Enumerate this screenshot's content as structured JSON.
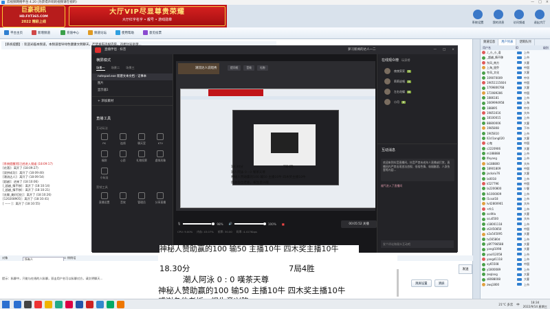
{
  "window": {
    "title": "云视频网络平台 4.20 (为获得声响的视频请在视听)",
    "controls": [
      "—",
      "□",
      "×"
    ]
  },
  "banner": {
    "logo_line1": "巨豪視訊",
    "logo_line2": "HD.FXT365.COM",
    "logo_line3": "2022 精彩上线",
    "vip_line1": "大厅VIP尽显尊贵荣耀",
    "vip_line2": "大厅红字名字 • 靓号 • 游戏勋章"
  },
  "toolbar": {
    "items": [
      {
        "label": "平台主页",
        "color": "#2f7fd0"
      },
      {
        "label": "新增频道",
        "color": "#d04848"
      },
      {
        "label": "充值中心",
        "color": "#3aa04a"
      },
      {
        "label": "频道论坛",
        "color": "#e09a22"
      },
      {
        "label": "使用帮助",
        "color": "#2f9fe0"
      },
      {
        "label": "意见投票",
        "color": "#8a4ad0"
      }
    ],
    "right": [
      {
        "label": "系统设置",
        "color": "#3a78c8"
      },
      {
        "label": "我的消息",
        "color": "#3a78c8"
      },
      {
        "label": "访问频道",
        "color": "#3a78c8"
      },
      {
        "label": "退出大厅",
        "color": "#3a78c8"
      }
    ]
  },
  "notice": "【系统提醒】: 欢迎光临本频道，本频道倡导绿色健康文明聊天，严禁发布违规内容，违者封号处理...",
  "chat": {
    "lines": [
      "[系统提醒]您已经进入频道 (18:09:17)",
      "[花落]：离开了 (18:09:27)",
      "[双拼成功]：离开了 (18:09:40)",
      "[潮流达人]：离开了 (18:09:54)",
      "[超越]：进来了 (18:10:06)",
      "[_超越_情不移]：离开了 (18:10:14)",
      "[_超越_情不移]：离开了 (18:10:21)",
      "[无聊_美好回忆]：离开了 (18:10:26)",
      "[120208905]：离开了 (18:10:41)",
      "[ —— ]：离开了 (18:10:55)"
    ]
  },
  "input": {
    "target_label": "对象",
    "target_value": "所有人",
    "private_label": "悄悄话",
    "send": "发送"
  },
  "broadcast": "提示：私聊中，只能与在线的人私聊，双击用户名可以私聊对方，请文明聊天...",
  "bottom_buttons": [
    "清屏设置",
    "清屏"
  ],
  "right_panel": {
    "tabs": [
      "频道信息",
      "用户列表",
      "话筒队列"
    ],
    "head": [
      "用户名",
      "ID",
      "级别"
    ],
    "users": [
      {
        "name": "♪_小_小_语",
        "id": "上市",
        "c": "#e05a5a"
      },
      {
        "name": "_超越_情不移",
        "id": "上市",
        "c": "#4aa04a"
      },
      {
        "name": "东风_南方",
        "id": "大客",
        "c": "#e05a5a"
      },
      {
        "name": "上海_银乔",
        "id": "中国",
        "c": "#e0a040"
      },
      {
        "name": "冬凤_文化",
        "id": "大客",
        "c": "#4aa04a"
      },
      {
        "name": "109070009",
        "id": "中华",
        "c": "#4aa04a"
      },
      {
        "name": "19051115604",
        "id": "中国",
        "c": "#e05a5a"
      },
      {
        "name": "1769806768",
        "id": "大客",
        "c": "#4aa04a"
      },
      {
        "name": "172089286",
        "id": "中国",
        "c": "#e0a040"
      },
      {
        "name": "1886181",
        "id": "上市",
        "c": "#4aa04a"
      },
      {
        "name": "1669994958",
        "id": "上海",
        "c": "#4aa04a"
      },
      {
        "name": "188895",
        "id": "中华",
        "c": "#4aa04a"
      },
      {
        "name": "19851616",
        "id": "大市",
        "c": "#e05a5a"
      },
      {
        "name": "18100015",
        "id": "上市",
        "c": "#4aa04a"
      },
      {
        "name": "88800006",
        "id": "大客",
        "c": "#4aa04a"
      },
      {
        "name": "1985808",
        "id": "下市",
        "c": "#e0a040"
      },
      {
        "name": "1905810",
        "id": "上市",
        "c": "#4aa04a"
      },
      {
        "name": "ll2cl1ang020",
        "id": "大客",
        "c": "#4aa04a"
      },
      {
        "name": "心鬼",
        "id": "中国",
        "c": "#e05a5a"
      },
      {
        "name": "c2220906",
        "id": "大客",
        "c": "#4aa04a"
      },
      {
        "name": "m188888",
        "id": "上市",
        "c": "#4aa04a"
      },
      {
        "name": "lfeyang",
        "id": "上市",
        "c": "#4aa04a"
      },
      {
        "name": "la188800",
        "id": "大市",
        "c": "#e0a040"
      },
      {
        "name": "18901809",
        "id": "中国",
        "c": "#4aa04a"
      },
      {
        "name": "jackalu76",
        "id": "大客",
        "c": "#4aa04a"
      },
      {
        "name": "la0018",
        "id": "上市",
        "c": "#4aa04a"
      },
      {
        "name": "k527796",
        "id": "中国",
        "c": "#e05a5a"
      },
      {
        "name": "la2200800",
        "id": "少客",
        "c": "#4aa04a"
      },
      {
        "name": "lk1000009",
        "id": "上市",
        "c": "#4aa04a"
      },
      {
        "name": "l1csal18",
        "id": "上市",
        "c": "#4aa04a"
      },
      {
        "name": "lv42800901",
        "id": "大市",
        "c": "#e0a040"
      },
      {
        "name": "•rfc1",
        "id": "上市",
        "c": "#e05a5a"
      },
      {
        "name": "scdltla",
        "id": "大客",
        "c": "#4aa04a"
      },
      {
        "name": "scu0500",
        "id": "大市",
        "c": "#4aa04a"
      },
      {
        "name": "s18001118",
        "id": "上市",
        "c": "#4aa04a"
      },
      {
        "name": "st2450850",
        "id": "中国",
        "c": "#4aa04a"
      },
      {
        "name": "x2a545095",
        "id": "大客",
        "c": "#e0a040"
      },
      {
        "name": "tu56580d",
        "id": "上市",
        "c": "#4aa04a"
      },
      {
        "name": "y8f7798588",
        "id": "大客",
        "c": "#4aa04a"
      },
      {
        "name": "yangl1098",
        "id": "大客",
        "c": "#4aa04a"
      },
      {
        "name": "youll12058",
        "id": "上市",
        "c": "#4aa04a"
      },
      {
        "name": "yangd1118",
        "id": "上市",
        "c": "#e05a5a"
      },
      {
        "name": "xy65508",
        "id": "中国",
        "c": "#4aa04a"
      },
      {
        "name": "y1800089",
        "id": "上市",
        "c": "#4aa04a"
      },
      {
        "name": "zeqlang",
        "id": "大客",
        "c": "#4aa04a"
      },
      {
        "name": "z8088008",
        "id": "大客",
        "c": "#4aa04a"
      },
      {
        "name": "zwq1800",
        "id": "上市",
        "c": "#e0a040"
      }
    ]
  },
  "obs": {
    "title": "直播伴侣 · 抖音",
    "user": "萝习新闻的达人一二",
    "controls": [
      "—",
      "□",
      "×"
    ],
    "scenes_title": "横屏模式",
    "scene_tabs": [
      "场景一",
      "场景二",
      "场景三"
    ],
    "sources": [
      "notepad.exe 新建文本文档 - 记事本",
      "图片",
      "显示器1"
    ],
    "add_source": "+ 添加素材",
    "tools_title": "直播工具",
    "tools_sub": "互动玩法",
    "tools": [
      "PK",
      "连线",
      "聊天室",
      "KTV",
      "福袋",
      "心愿",
      "礼物投票",
      "虚拟形象",
      "小玩法"
    ],
    "tools_sub2": "营销工具",
    "tools2": [
      "直播设置",
      "音效",
      "管理员",
      "分享直播"
    ],
    "preview_name": "潮流达人说唱秀",
    "preview_tabs": [
      "提问框",
      "音效",
      "礼物"
    ],
    "overlay": {
      "line1": "18:30分",
      "line1b": "7局4胜",
      "line2": "潮人阿泳  0 : 0  嘆茶天尊",
      "line3": "神秘人赞助赢的100 输50  主播10牛  四木奖主播10牛",
      "line4": "感谢各位老板，祝生意兴隆"
    },
    "mic_pct": "98%",
    "spk_pct": "100%",
    "go_live": "00:05:52 关播",
    "stats": [
      "CPU: 9.00%",
      "内存: 43.07%",
      "帧率: 30.00",
      "码率: 4.417Kbps"
    ],
    "right_title": "在线观众榜",
    "right_sub": "玩家榜",
    "fans": [
      {
        "name": "夜夜家家",
        "badge": "9"
      },
      {
        "name": "莉莉说唱",
        "badge": "9"
      },
      {
        "name": "左右花蝶",
        "badge": "8"
      },
      {
        "name": "小月",
        "badge": "8"
      }
    ],
    "interact_title": "互动消息",
    "msg1": "欢迎来到抖音直播间，抖音严禁未成年人直播或打赏，直播间内严禁出现违法违规、低俗色情、吸烟酗酒、人身伤害等内容...",
    "msg2": "福气进入了直播间",
    "input_ph": "发个评论和观众互动吧"
  },
  "captions": {
    "top": "神秘人赞助赢的100 输50  主播10牛  四木奖主播10牛",
    "line1a": "18.30分",
    "line1b": "7局4胜",
    "line2": "潮人阿泳    0 : 0    嘆茶天尊",
    "line3": "神秘人赞助赢的100 输50   主播10牛   四木奖主播10牛",
    "line4": "感谢各位老板，祝生意兴隆"
  },
  "taskbar": {
    "apps": [
      "#2b6fd0",
      "#444",
      "#e33",
      "#f0b400",
      "#2a8",
      "#d04",
      "#25a",
      "#c22",
      "#38c",
      "#0a6",
      "#e70"
    ],
    "weather": "21°C 多云",
    "ime": "中",
    "time": "18:34",
    "date": "2022/9/14 星期三"
  }
}
